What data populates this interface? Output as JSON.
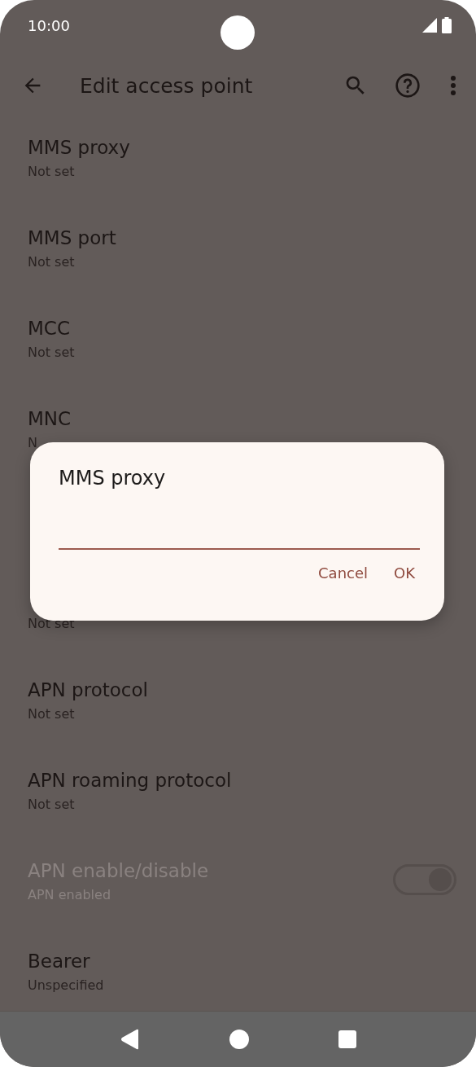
{
  "status_bar": {
    "time": "10:00"
  },
  "app_bar": {
    "title": "Edit access point"
  },
  "rows": [
    {
      "kind": "pref",
      "title": "MMS proxy",
      "summary": "Not set"
    },
    {
      "kind": "pref",
      "title": "MMS port",
      "summary": "Not set"
    },
    {
      "kind": "pref",
      "title": "MCC",
      "summary": "Not set"
    },
    {
      "kind": "pref",
      "title": "MNC",
      "summary": "N"
    },
    {
      "kind": "pref"
    },
    {
      "kind": "pref",
      "summary": "Not set"
    },
    {
      "kind": "pref",
      "title": "APN protocol",
      "summary": "Not set"
    },
    {
      "kind": "pref",
      "title": "APN roaming protocol",
      "summary": "Not set"
    },
    {
      "kind": "switch",
      "title": "APN enable/disable",
      "summary": "APN enabled",
      "disabled": true,
      "on": true
    },
    {
      "kind": "pref",
      "title": "Bearer",
      "summary": "Unspecified"
    }
  ],
  "dialog": {
    "title": "MMS proxy",
    "buttons": [
      "Cancel",
      "OK"
    ]
  }
}
